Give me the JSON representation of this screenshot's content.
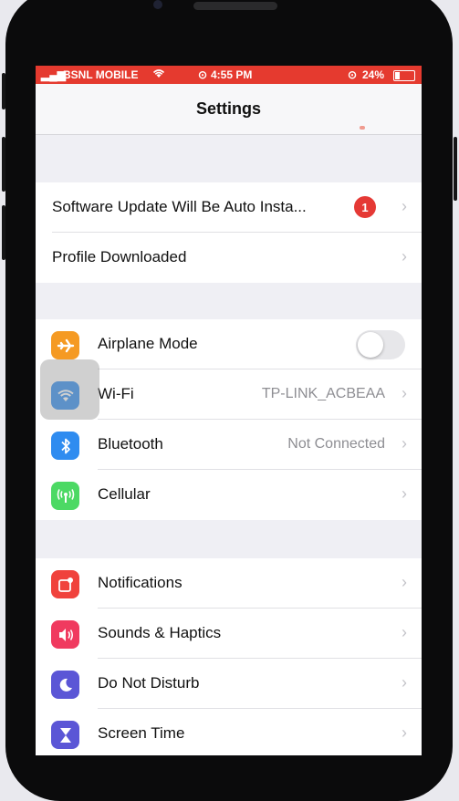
{
  "status_bar": {
    "carrier": "BSNL MOBILE",
    "time": "4:55 PM",
    "battery": "24%",
    "bg_color": "#e53a2f"
  },
  "nav": {
    "title": "Settings"
  },
  "top_group": [
    {
      "label": "Software Update Will Be Auto Insta...",
      "badge": "1"
    },
    {
      "label": "Profile Downloaded"
    }
  ],
  "connectivity": [
    {
      "label": "Airplane Mode",
      "icon": "airplane-icon",
      "color": "#f59a23",
      "toggle": "off"
    },
    {
      "label": "Wi-Fi",
      "icon": "wifi-icon",
      "color": "#2f8cf0",
      "value": "TP-LINK_ACBEAA"
    },
    {
      "label": "Bluetooth",
      "icon": "bluetooth-icon",
      "color": "#2f8cf0",
      "value": "Not Connected"
    },
    {
      "label": "Cellular",
      "icon": "cellular-icon",
      "color": "#4cd964"
    }
  ],
  "system": [
    {
      "label": "Notifications",
      "icon": "notifications-icon",
      "color": "#f0423c"
    },
    {
      "label": "Sounds & Haptics",
      "icon": "speaker-icon",
      "color": "#f03a5f"
    },
    {
      "label": "Do Not Disturb",
      "icon": "moon-icon",
      "color": "#5b56d6"
    },
    {
      "label": "Screen Time",
      "icon": "hourglass-icon",
      "color": "#5b56d6"
    }
  ]
}
